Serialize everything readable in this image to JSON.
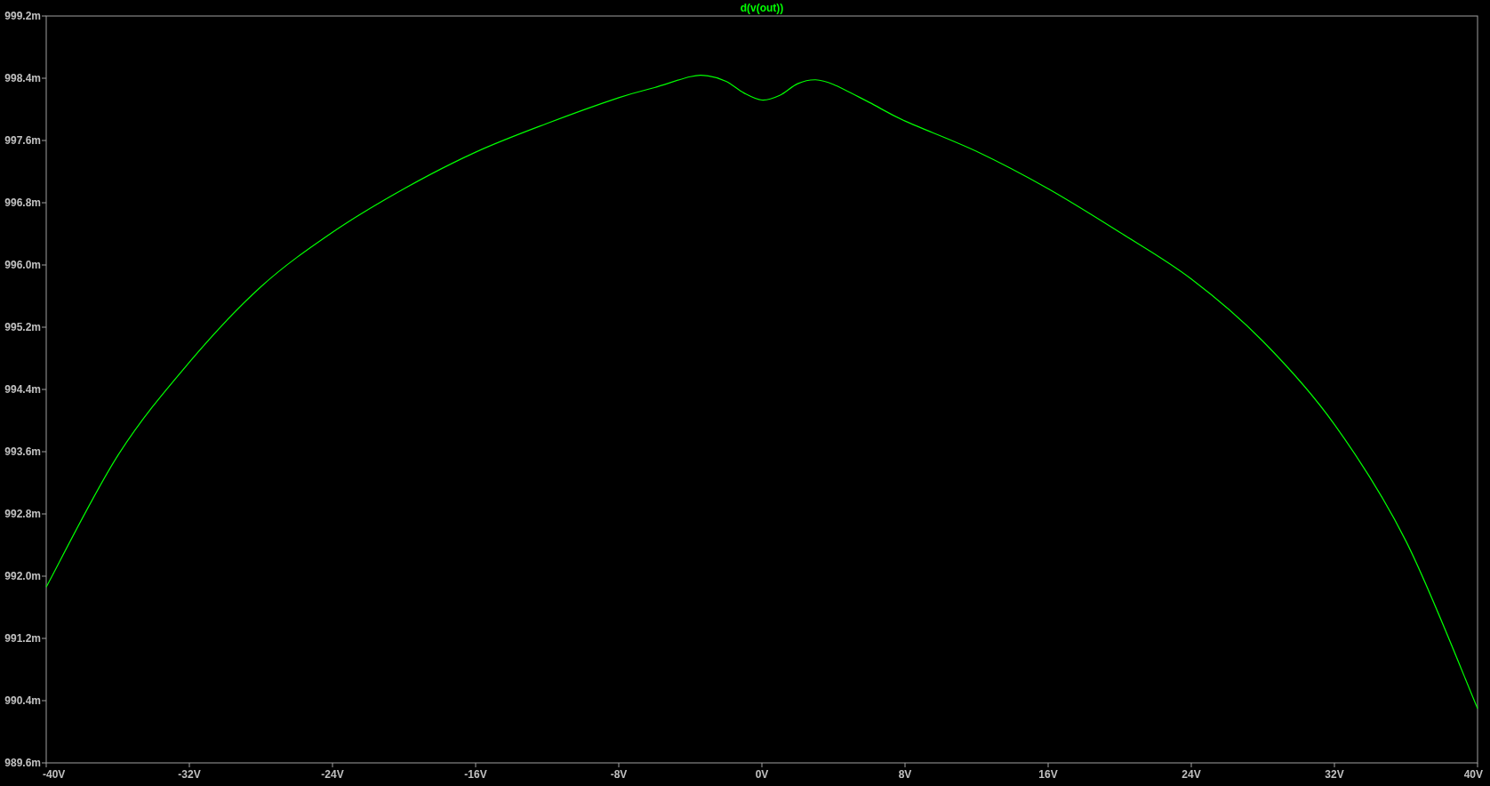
{
  "plot": {
    "chart_data": {
      "type": "line",
      "series": [
        {
          "name": "d(v(out))",
          "color": "#00ff00",
          "values": [
            991.86,
            993.55,
            994.75,
            995.72,
            996.42,
            996.98,
            997.45,
            997.82,
            998.15,
            998.28,
            998.42,
            998.43,
            998.36,
            998.21,
            998.12,
            998.18,
            998.33,
            998.38,
            998.32,
            998.09,
            997.85,
            997.46,
            996.98,
            996.42,
            995.82,
            995.02,
            993.95,
            992.45,
            990.3
          ]
        }
      ],
      "x": [
        -40,
        -36,
        -32,
        -28,
        -24,
        -20,
        -16,
        -12,
        -8,
        -6,
        -4,
        -3,
        -2,
        -1,
        0,
        1,
        2,
        3,
        4,
        6,
        8,
        12,
        16,
        20,
        24,
        28,
        32,
        36,
        40
      ],
      "xlim": [
        -40,
        40
      ],
      "ylim": [
        989.6,
        999.2
      ],
      "xticks": [
        {
          "value": -40,
          "label": "-40V"
        },
        {
          "value": -32,
          "label": "-32V"
        },
        {
          "value": -24,
          "label": "-24V"
        },
        {
          "value": -16,
          "label": "-16V"
        },
        {
          "value": -8,
          "label": "-8V"
        },
        {
          "value": 0,
          "label": "0V"
        },
        {
          "value": 8,
          "label": "8V"
        },
        {
          "value": 16,
          "label": "16V"
        },
        {
          "value": 24,
          "label": "24V"
        },
        {
          "value": 32,
          "label": "32V"
        },
        {
          "value": 40,
          "label": "40V"
        }
      ],
      "yticks": [
        {
          "value": 999.2,
          "label": "999.2m"
        },
        {
          "value": 998.4,
          "label": "998.4m"
        },
        {
          "value": 997.6,
          "label": "997.6m"
        },
        {
          "value": 996.8,
          "label": "996.8m"
        },
        {
          "value": 996.0,
          "label": "996.0m"
        },
        {
          "value": 995.2,
          "label": "995.2m"
        },
        {
          "value": 994.4,
          "label": "994.4m"
        },
        {
          "value": 993.6,
          "label": "993.6m"
        },
        {
          "value": 992.8,
          "label": "992.8m"
        },
        {
          "value": 992.0,
          "label": "992.0m"
        },
        {
          "value": 991.2,
          "label": "991.2m"
        },
        {
          "value": 990.4,
          "label": "990.4m"
        },
        {
          "value": 989.6,
          "label": "989.6m"
        }
      ]
    }
  }
}
